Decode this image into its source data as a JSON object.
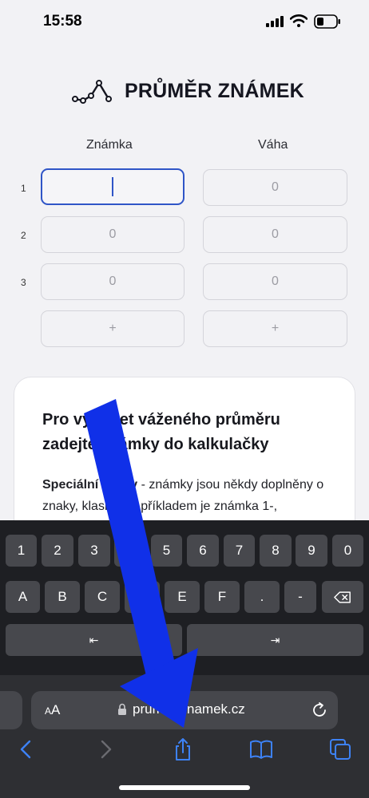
{
  "status_bar": {
    "time": "15:58"
  },
  "header": {
    "title": "PRŮMĚR ZNÁMEK"
  },
  "grid": {
    "grade_header": "Známka",
    "weight_header": "Váha",
    "rows": [
      {
        "num": "1",
        "grade": "",
        "weight": "0"
      },
      {
        "num": "2",
        "grade": "0",
        "weight": "0"
      },
      {
        "num": "3",
        "grade": "0",
        "weight": "0"
      }
    ],
    "add_label": "+"
  },
  "card": {
    "title": "Pro výpočet váženého průměru zadejte známky do kalkulačky",
    "special_label": "Speciální znaky",
    "special_text": " - známky jsou někdy doplněny o znaky, klasickým příkladem je známka 1-, kalkulačka znaky automaticky"
  },
  "keyboard": {
    "row1": [
      "1",
      "2",
      "3",
      "4",
      "5",
      "6",
      "7",
      "8",
      "9",
      "0"
    ],
    "row2": [
      "A",
      "B",
      "C",
      "D",
      "E",
      "F",
      ".",
      "-",
      "⌫"
    ],
    "prev_label": "⇤",
    "next_label": "⇥"
  },
  "browser": {
    "aa_small": "A",
    "aa_large": "A",
    "url": "prumer-znamek.cz"
  },
  "colors": {
    "accent": "#2f55c7",
    "overlay_arrow": "#1030e8",
    "toolbar_icon": "#3d82f6"
  }
}
